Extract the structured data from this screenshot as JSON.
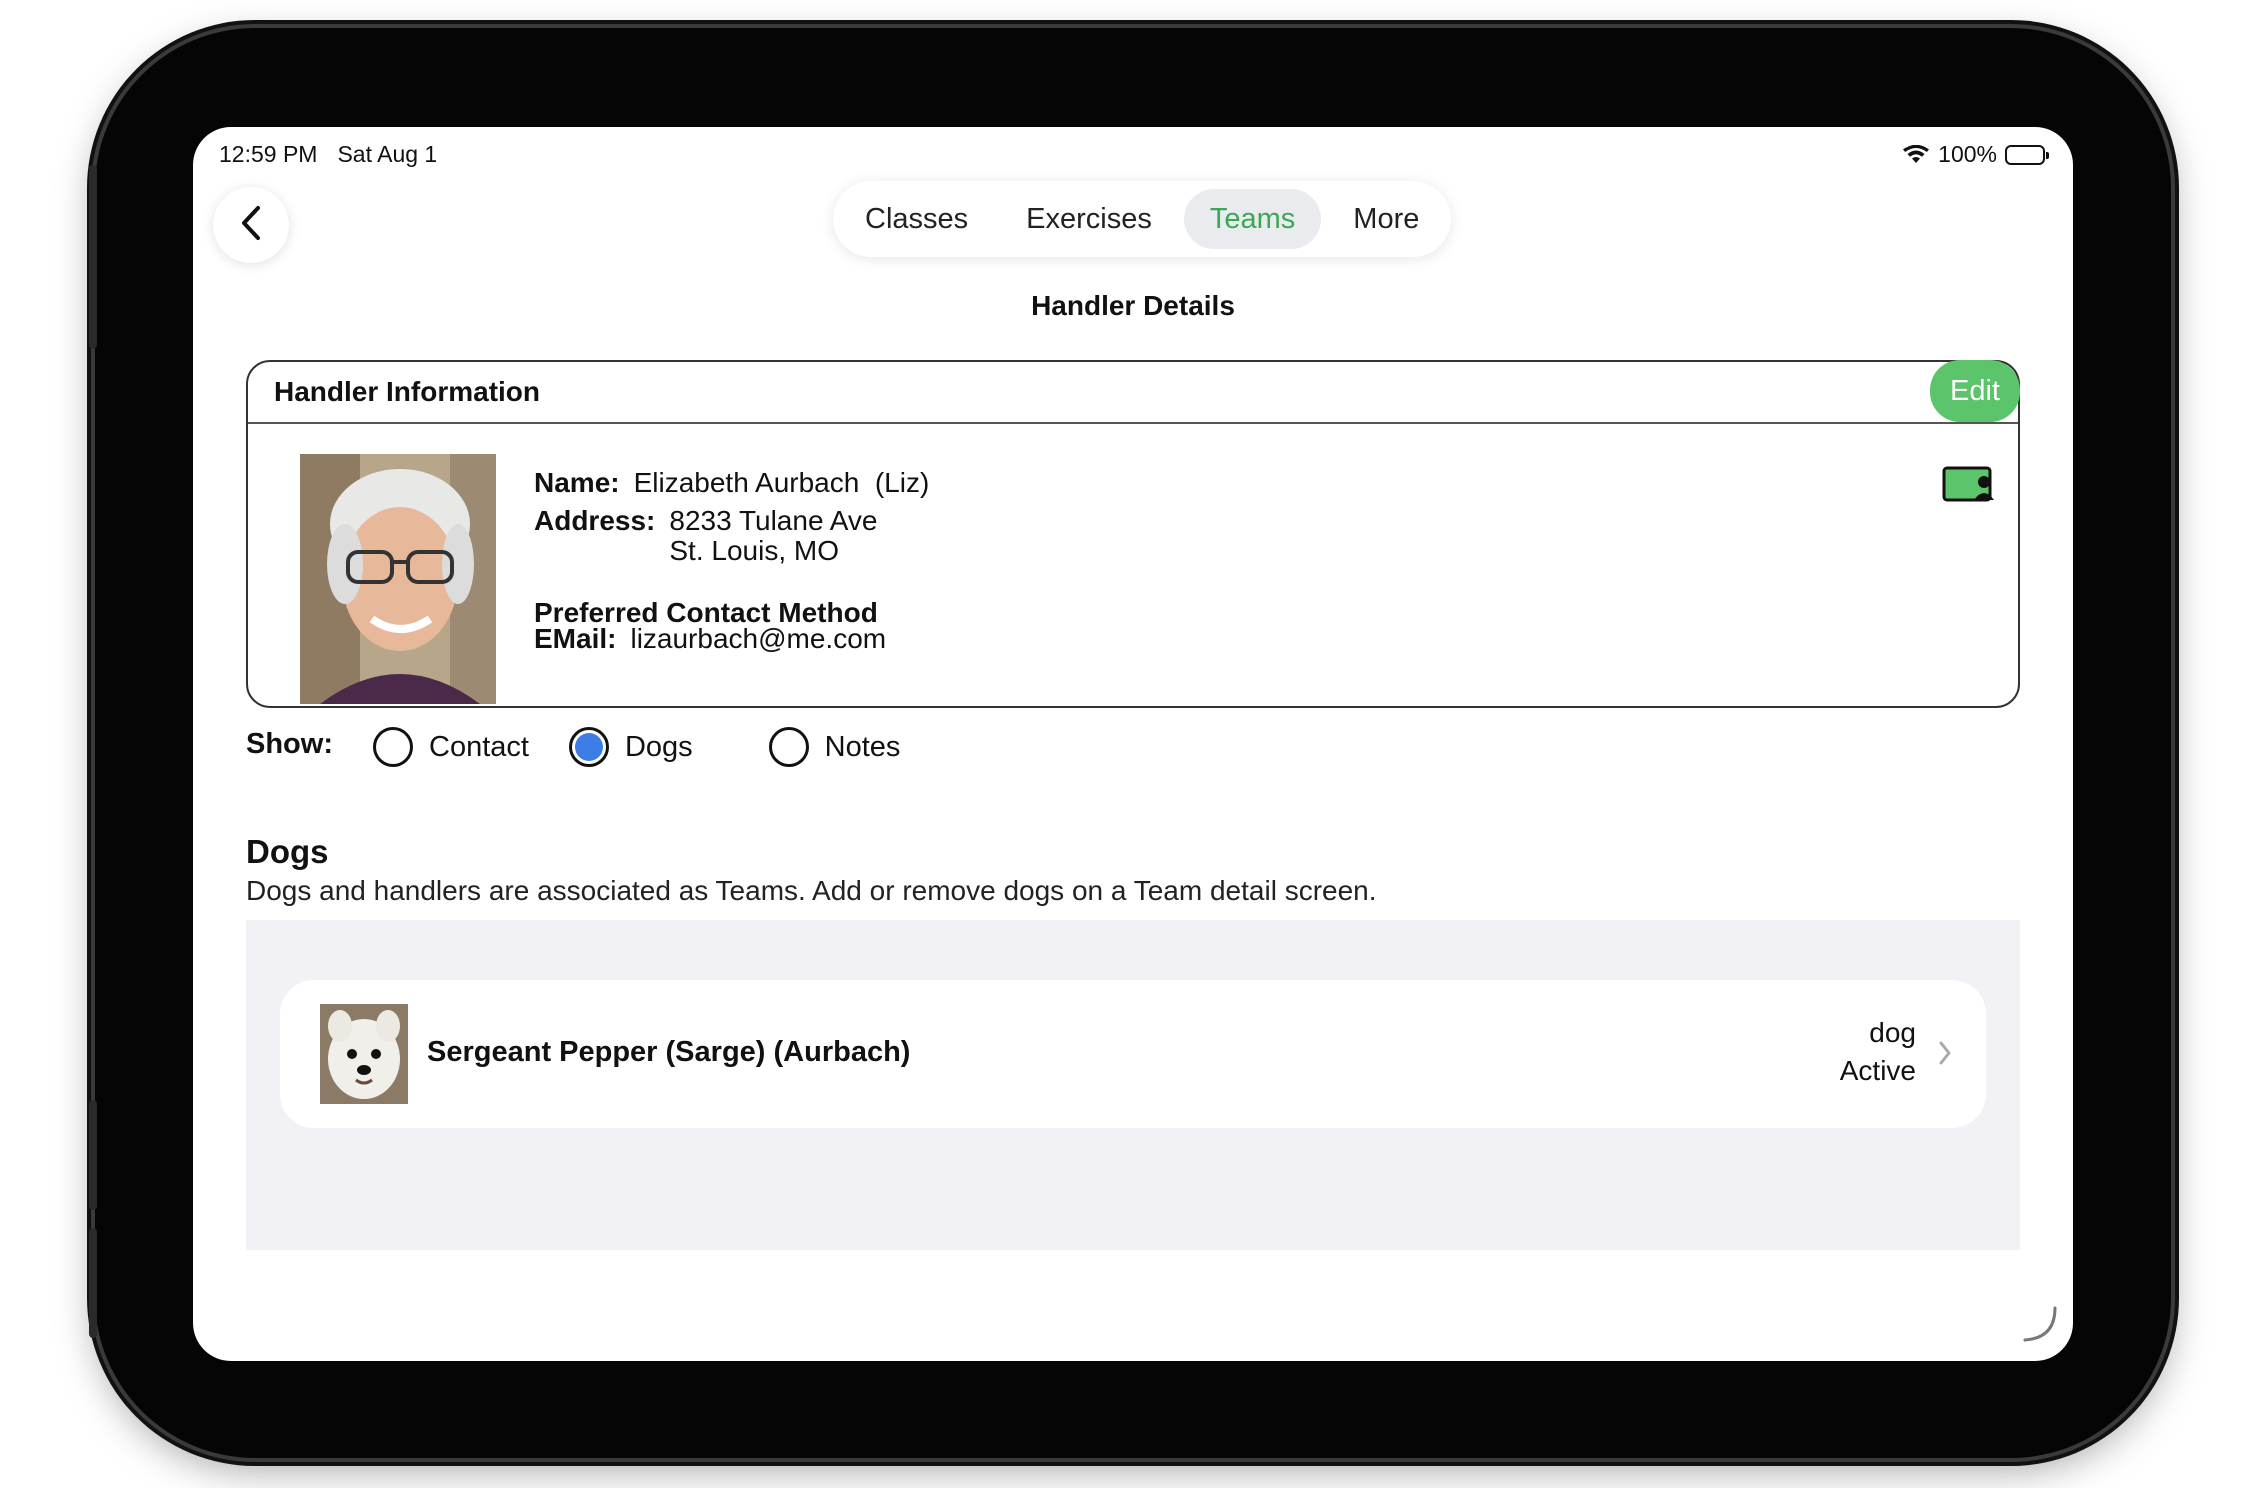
{
  "status_bar": {
    "time": "12:59 PM",
    "date": "Sat Aug 1",
    "battery": "100%"
  },
  "nav": {
    "tabs": [
      {
        "label": "Classes",
        "active": false
      },
      {
        "label": "Exercises",
        "active": false
      },
      {
        "label": "Teams",
        "active": true
      },
      {
        "label": "More",
        "active": false
      }
    ]
  },
  "page_title": "Handler Details",
  "handler_card": {
    "title": "Handler Information",
    "edit_label": "Edit",
    "name_label": "Name:",
    "name_value": "Elizabeth Aurbach  (Liz)",
    "address_label": "Address:",
    "address_line1": "8233 Tulane Ave",
    "address_line2": "St. Louis, MO",
    "preferred_contact_label": "Preferred Contact Method",
    "email_label": "EMail:",
    "email_value": "lizaurbach@me.com"
  },
  "show": {
    "label": "Show:",
    "options": [
      {
        "label": "Contact",
        "checked": false
      },
      {
        "label": "Dogs",
        "checked": true
      },
      {
        "label": "Notes",
        "checked": false
      }
    ]
  },
  "dogs_section": {
    "title": "Dogs",
    "description": "Dogs and handlers are associated as Teams. Add or remove dogs on a Team detail screen.",
    "items": [
      {
        "name": "Sergeant Pepper (Sarge) (Aurbach)",
        "type": "dog",
        "status": "Active"
      }
    ]
  },
  "colors": {
    "accent_green": "#3aa855",
    "edit_green": "#5cc46a",
    "radio_blue": "#3d7ee6"
  }
}
